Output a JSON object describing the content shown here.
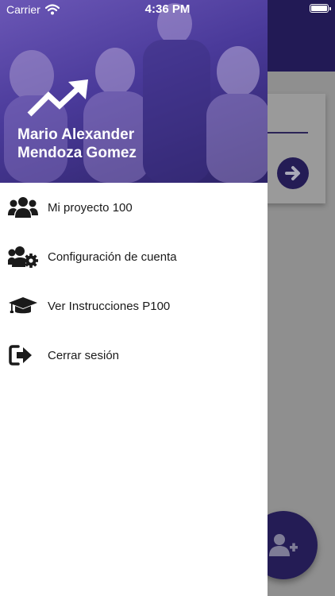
{
  "status_bar": {
    "carrier": "Carrier",
    "time": "4:36 PM"
  },
  "drawer": {
    "user": {
      "first_line": "Mario Alexander",
      "second_line": "Mendoza Gomez"
    },
    "menu_items": [
      {
        "label": "Mi proyecto 100",
        "icon": "users-icon"
      },
      {
        "label": "Configuración de cuenta",
        "icon": "users-gear-icon"
      },
      {
        "label": "Ver Instrucciones P100",
        "icon": "graduation-cap-icon"
      },
      {
        "label": "Cerrar sesión",
        "icon": "sign-out-icon"
      }
    ]
  },
  "colors": {
    "primary": "#241c55",
    "header_gradient_start": "#6b57b6",
    "header_gradient_end": "#2c2266",
    "scrim": "#8f8f8f"
  }
}
